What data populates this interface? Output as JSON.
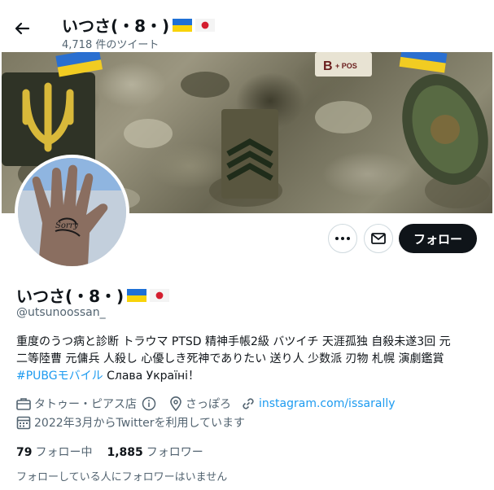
{
  "header": {
    "name": "いつさ(・8・)",
    "tweet_count": "4,718 件のツイート"
  },
  "profile": {
    "name": "いつさ(・8・)",
    "handle": "@utsunoossan_",
    "bio_lines": [
      "重度のうつ病と診断 トラウマ PTSD 精神手帳2級 バツイチ 天涯孤独 自殺未遂3回 元",
      "二等陸曹 元傭兵 人殺し 心優しき死神でありたい 送り人 少数派 刃物 札幌 演劇鑑賞"
    ],
    "bio_hashtag": "#PUBGモバイル",
    "bio_tail": " Слава Україні！",
    "location_tag": "タトゥー・ピアス店",
    "city": "さっぽろ",
    "link": "instagram.com/issarally",
    "joined": "2022年3月からTwitterを利用しています",
    "following_count": "79",
    "following_label": "フォロー中",
    "followers_count": "1,885",
    "followers_label": "フォロワー",
    "note": "フォローしている人にフォロワーはいません"
  },
  "actions": {
    "follow_label": "フォロー"
  },
  "icons": [
    "back-arrow-icon",
    "more-icon",
    "mail-icon",
    "briefcase-icon",
    "info-icon",
    "location-icon",
    "link-icon",
    "calendar-icon",
    "ukraine-flag-icon",
    "japan-flag-icon"
  ],
  "colors": {
    "accent": "#1d9bf0",
    "text": "#0f1419",
    "muted": "#536471",
    "button": "#0f1419"
  }
}
